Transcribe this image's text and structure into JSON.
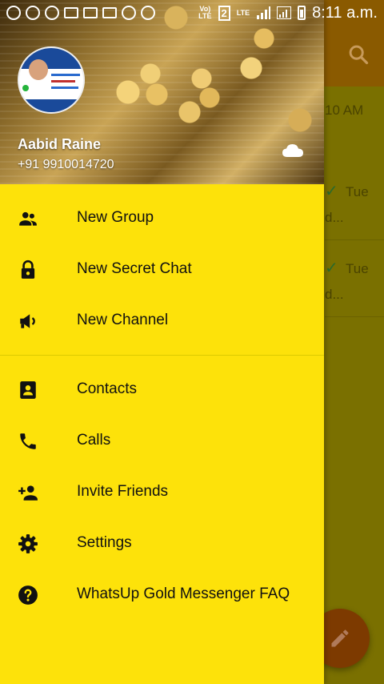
{
  "status_bar": {
    "volte": "Vo)\nLTE",
    "sim": "2",
    "lte": "LTE",
    "time": "8:11 a.m."
  },
  "background": {
    "timestamp": "10 AM",
    "rows": [
      {
        "day": "Tue",
        "snippet": "d..."
      },
      {
        "day": "Tue",
        "snippet": "d..."
      }
    ]
  },
  "drawer": {
    "header": {
      "name": "Aabid Raine",
      "phone": "+91 9910014720",
      "avatar_text": "DIGITAL INDIA"
    },
    "menu_group_1": [
      {
        "label": "New Group",
        "icon": "group-icon"
      },
      {
        "label": "New Secret Chat",
        "icon": "lock-icon"
      },
      {
        "label": "New Channel",
        "icon": "megaphone-icon"
      }
    ],
    "menu_group_2": [
      {
        "label": "Contacts",
        "icon": "contacts-icon"
      },
      {
        "label": "Calls",
        "icon": "phone-icon"
      },
      {
        "label": "Invite Friends",
        "icon": "add-person-icon"
      },
      {
        "label": "Settings",
        "icon": "gear-icon"
      },
      {
        "label": "WhatsUp Gold Messenger FAQ",
        "icon": "help-icon"
      }
    ]
  },
  "colors": {
    "drawer_background": "#fde20a",
    "scrim_app": "#7a7000",
    "fab": "#7d3a00"
  }
}
